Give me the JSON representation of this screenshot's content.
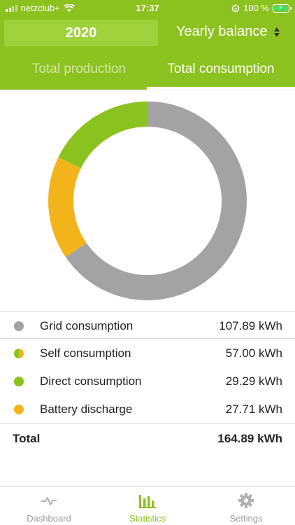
{
  "status_bar": {
    "carrier": "netzclub+",
    "time": "17:37",
    "battery": "100 %"
  },
  "header": {
    "year": "2020",
    "period": "Yearly balance",
    "tabs": [
      {
        "label": "Total production",
        "active": false
      },
      {
        "label": "Total consumption",
        "active": true
      }
    ]
  },
  "colors": {
    "brand_green": "#8cc21f",
    "grid": "#a3a3a3",
    "direct": "#8cc21f",
    "battery": "#f3b41b"
  },
  "chart_data": {
    "type": "pie",
    "style": "donut",
    "slices": [
      {
        "name": "Grid consumption",
        "value": 107.89,
        "color": "#a3a3a3"
      },
      {
        "name": "Battery discharge",
        "value": 27.71,
        "color": "#f3b41b"
      },
      {
        "name": "Direct consumption",
        "value": 29.29,
        "color": "#8cc21f"
      }
    ],
    "unit": "kWh"
  },
  "legend": {
    "rows": [
      {
        "label": "Grid consumption",
        "value": "107.89 kWh",
        "dot": "grid"
      },
      {
        "label": "Self consumption",
        "value": "57.00 kWh",
        "dot": "split"
      },
      {
        "label": "Direct consumption",
        "value": "29.29 kWh",
        "dot": "direct"
      },
      {
        "label": "Battery discharge",
        "value": "27.71 kWh",
        "dot": "battery"
      }
    ],
    "total_label": "Total",
    "total_value": "164.89 kWh"
  },
  "nav": {
    "items": [
      {
        "label": "Dashboard",
        "icon": "pulse-icon",
        "active": false
      },
      {
        "label": "Statistics",
        "icon": "bar-chart-icon",
        "active": true
      },
      {
        "label": "Settings",
        "icon": "gear-icon",
        "active": false
      }
    ]
  }
}
